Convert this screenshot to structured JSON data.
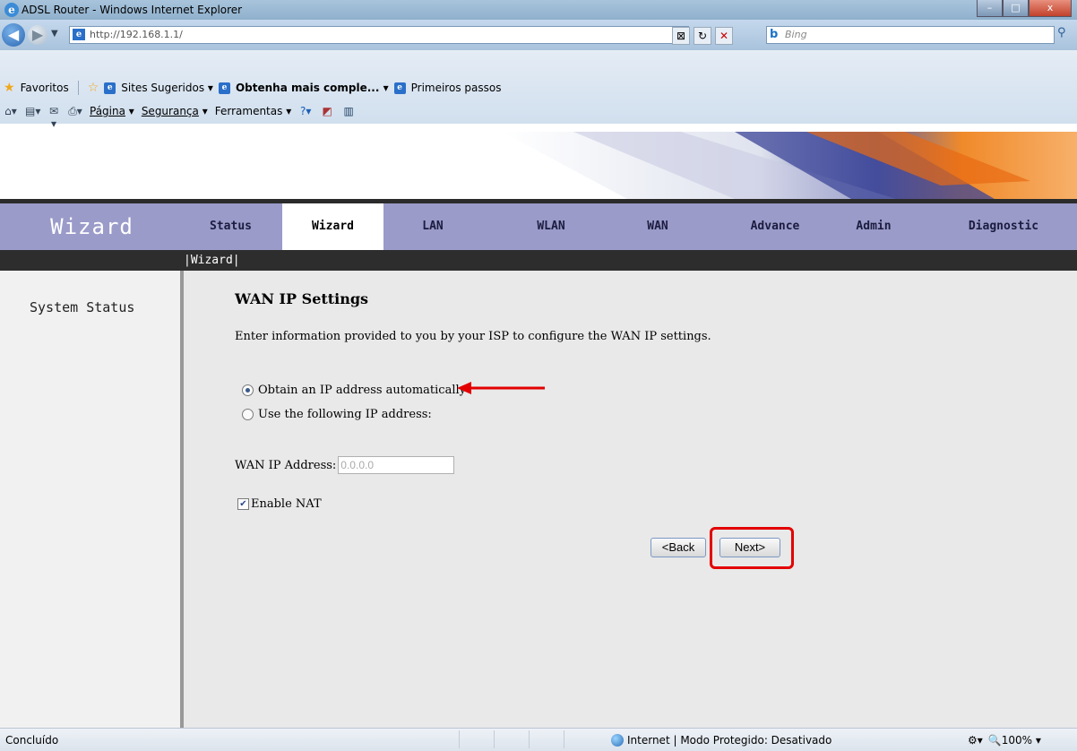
{
  "window": {
    "title": "ADSL Router - Windows Internet Explorer",
    "buttons": {
      "minimize": "–",
      "maximize": "□",
      "close": "x"
    }
  },
  "browser": {
    "address": "http://192.168.1.1/",
    "search_placeholder": "Bing",
    "favorites_label": "Favoritos",
    "favorites": [
      "Sites Sugeridos ▾",
      "Obtenha mais comple... ▾",
      "Primeiros passos"
    ],
    "commands": {
      "page": "Página",
      "security": "Segurança",
      "tools": "Ferramentas"
    }
  },
  "router": {
    "section_title": "Wizard",
    "tabs": [
      "Status",
      "Wizard",
      "LAN",
      "WLAN",
      "WAN",
      "Advance",
      "Admin",
      "Diagnostic"
    ],
    "active_tab": "Wizard",
    "subnav": "|Wizard|",
    "sidebar": [
      "System Status"
    ]
  },
  "form": {
    "heading": "WAN IP Settings",
    "description": "Enter information provided to you by your ISP to configure the WAN IP settings.",
    "option_auto": "Obtain an IP address automatically",
    "option_manual": "Use the following IP address:",
    "selected_option": "auto",
    "wan_ip_label": "WAN IP Address:",
    "wan_ip_value": "0.0.0.0",
    "nat_label": "Enable NAT",
    "nat_checked": true,
    "back_label": "<Back",
    "next_label": "Next>"
  },
  "statusbar": {
    "left": "Concluído",
    "zone": "Internet | Modo Protegido: Desativado",
    "zoom": "100%"
  },
  "colors": {
    "nav_bg": "#9a9bc9",
    "annotation_red": "#e20000",
    "content_bg": "#e9e9e9"
  }
}
